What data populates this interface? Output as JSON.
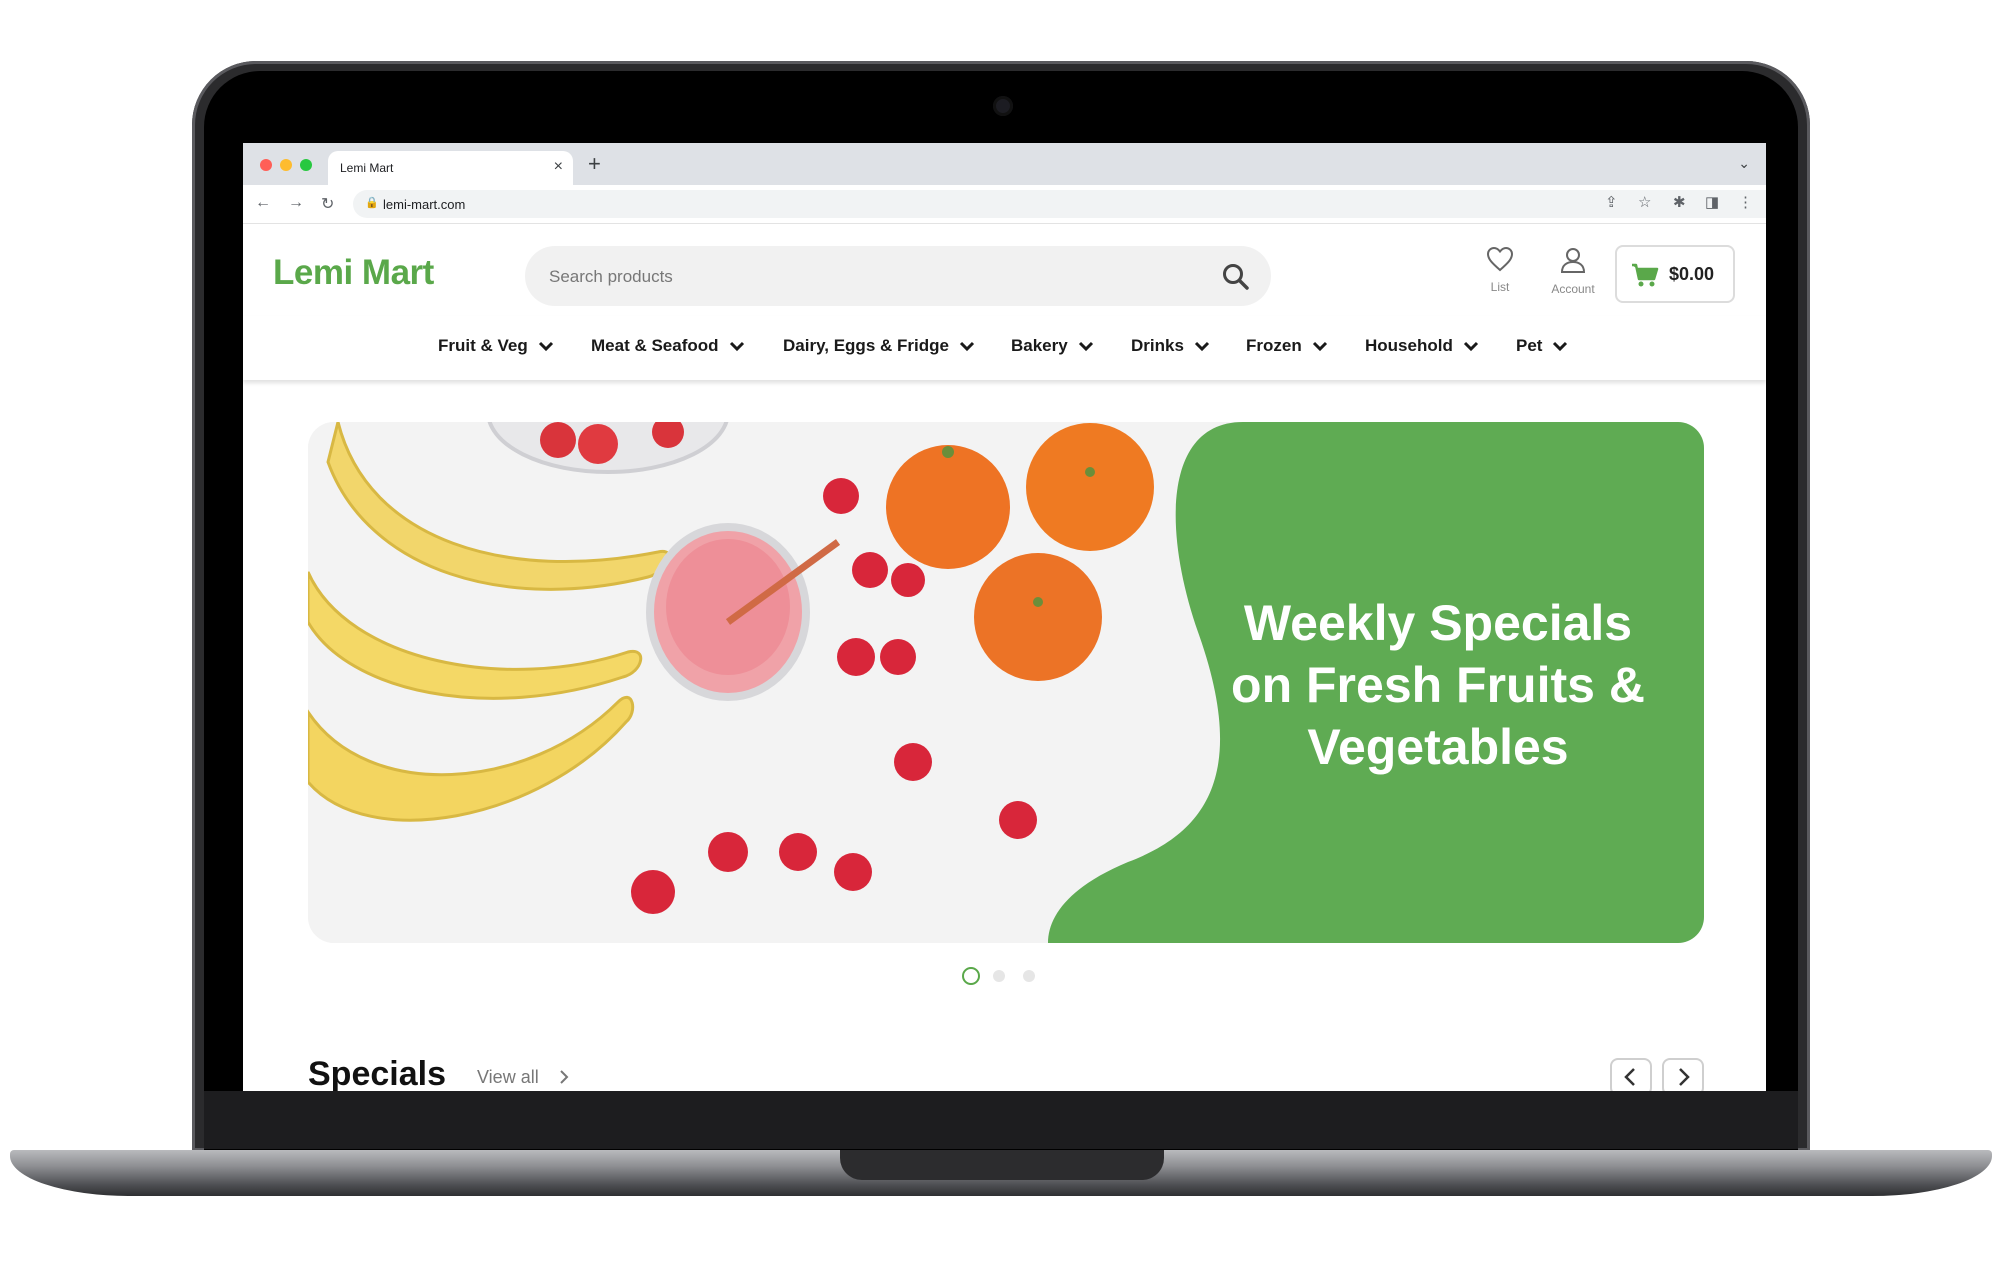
{
  "browser": {
    "tab_title": "Lemi Mart",
    "tab_close": "×",
    "new_tab": "+",
    "url": "lemi-mart.com"
  },
  "site": {
    "logo": "Lemi Mart",
    "search_placeholder": "Search products",
    "wishlist_label": "List",
    "account_label": "Account",
    "cart_total": "$0.00",
    "accent_color": "#5aa84a"
  },
  "categories": [
    {
      "label": "Fruit & Veg"
    },
    {
      "label": "Meat & Seafood"
    },
    {
      "label": "Dairy, Eggs & Fridge"
    },
    {
      "label": "Bakery"
    },
    {
      "label": "Drinks"
    },
    {
      "label": "Frozen"
    },
    {
      "label": "Household"
    },
    {
      "label": "Pet"
    }
  ],
  "hero": {
    "lines": [
      "Weekly Specials",
      "on Fresh Fruits &",
      "Vegetables"
    ],
    "slide_count": 3,
    "active_slide": 1
  },
  "specials": {
    "title": "Specials",
    "view_all": "View all"
  }
}
